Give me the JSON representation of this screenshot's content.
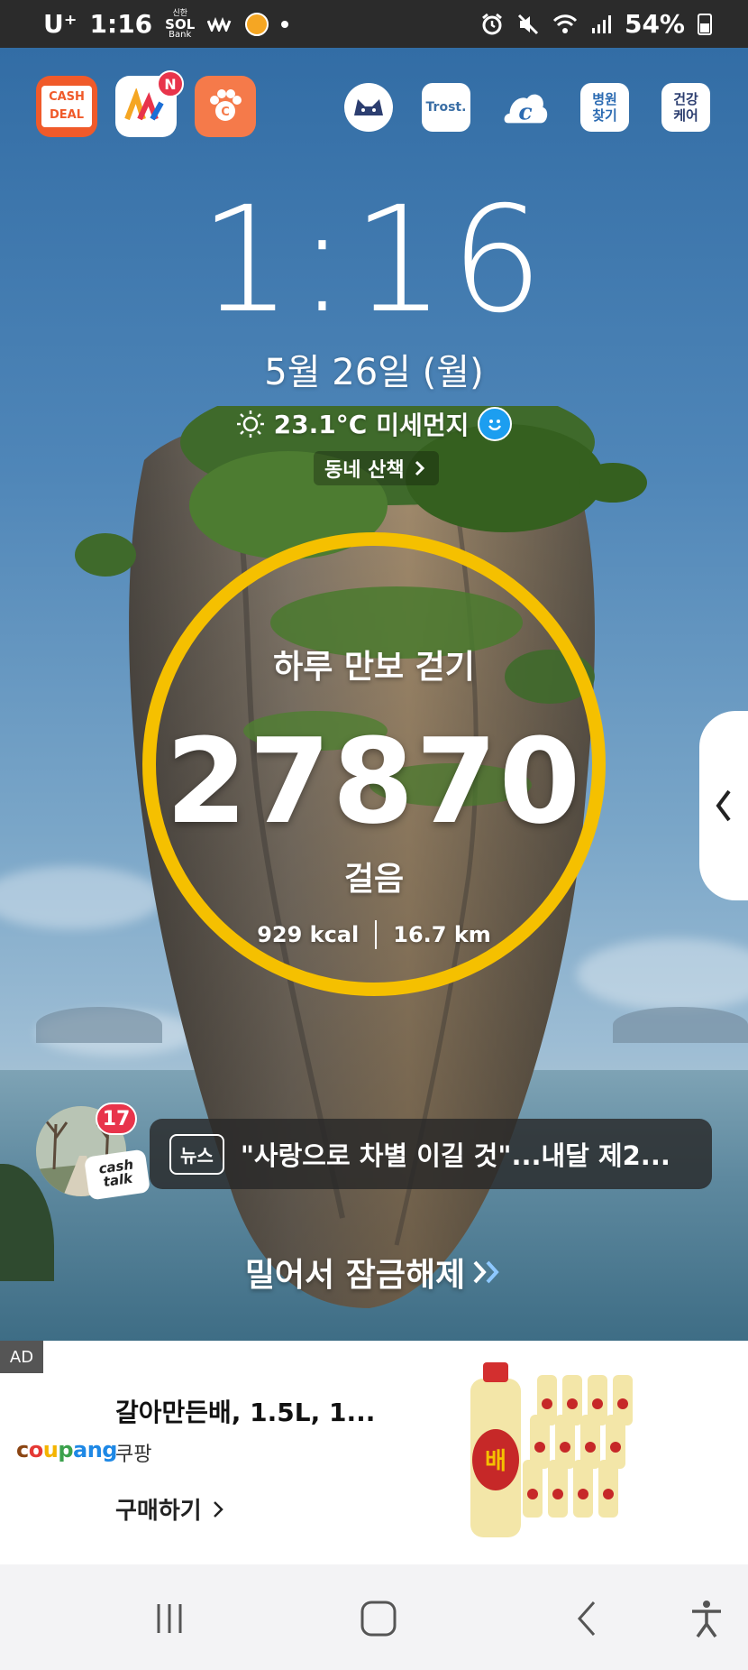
{
  "status_bar": {
    "carrier": "U⁺",
    "time": "1:16",
    "bank_top": "신한",
    "bank_logo": "SOL",
    "bank_sub": "Bank",
    "battery": "54%"
  },
  "top_apps": {
    "cashdeal_line1": "CASH",
    "cashdeal_line2": "DEAL",
    "badge_n": "N",
    "trost": "Trost.",
    "hospital_line1": "병원",
    "hospital_line2": "찾기",
    "health_line1": "건강",
    "health_line2": "케어"
  },
  "lock": {
    "clock": "1:16",
    "date": "5월 26일 (월)",
    "temperature": "23.1°C",
    "dust_label": "미세먼지",
    "walk_link": "동네 산책"
  },
  "steps": {
    "title": "하루 만보 걷기",
    "count": "27870",
    "unit": "걸음",
    "kcal": "929 kcal",
    "distance": "16.7 km",
    "ring_color": "#f5c000"
  },
  "cashtalk": {
    "badge": "17",
    "label_line1": "cash",
    "label_line2": "talk"
  },
  "news": {
    "tag": "뉴스",
    "headline": "\"사랑으로 차별 이길 것\"...내달 제2..."
  },
  "unlock": {
    "label": "밀어서 잠금해제"
  },
  "ad": {
    "tag": "AD",
    "brand_parts": [
      "c",
      "o",
      "u",
      "p",
      "ang"
    ],
    "title": "갈아만든배, 1.5L, 1...",
    "seller": "쿠팡",
    "buy": "구매하기"
  }
}
